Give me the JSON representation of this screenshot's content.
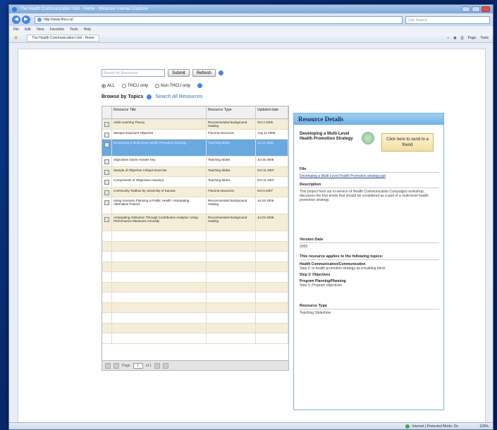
{
  "window": {
    "title": "The Health Communication Unit - Home - Windows Internet Explorer"
  },
  "address": {
    "url": "http://www.thcu.ca/",
    "search_placeholder": "Live Search"
  },
  "menu": [
    "File",
    "Edit",
    "View",
    "Favorites",
    "Tools",
    "Help"
  ],
  "favorites": {
    "tab_label": "The Health Communication Unit - Home",
    "page_btn": "Page",
    "tools_btn": "Tools"
  },
  "search": {
    "placeholder": "Search for Resources",
    "submit_label": "Submit",
    "refresh_label": "Refresh"
  },
  "filters": {
    "all": "ALL",
    "thcu": "THCU only",
    "non_thcu": "Non THCU only"
  },
  "browse": {
    "label": "Browse by Topics",
    "search_all": "Search All Resources"
  },
  "grid": {
    "headers": [
      "Resource Title",
      "Resource Type",
      "Updated date"
    ],
    "rows": [
      {
        "title": "Adult Learning Theory",
        "type": "Recommended background reading",
        "date": "Oct 4 2005"
      },
      {
        "title": "Mesquir Exposure Objective",
        "type": "Fiscal & resources",
        "date": "Aug 11 2006"
      },
      {
        "title": "Developing a Multi-Level Health Promotion Strategy",
        "type": "Teaching Slides",
        "date": "Jul 11 2006"
      },
      {
        "title": "Objectives Game Answer Key",
        "type": "Teaching Slides",
        "date": "Jul 26 2006"
      },
      {
        "title": "Sample of Objective Critique Exercise",
        "type": "Teaching Slides",
        "date": "Oct 11 2007"
      },
      {
        "title": "Components of Objectives Handout",
        "type": "Teaching Slides",
        "date": "Oct 11 2007"
      },
      {
        "title": "Community Toolbox by University of Kansas",
        "type": "Fiscal & resources",
        "date": "Oct 5 2007"
      },
      {
        "title": "Using Scenario Planning in Public Health: Anticipating Alternative Futures",
        "type": "Recommended background reading",
        "date": "Jul 26 2006"
      },
      {
        "title": "Anticipating Attribution Through Contribution Analysis: Using Performance Measures Annually",
        "type": "Recommended background reading",
        "date": "Jul 22 2006"
      }
    ],
    "empty_rows": 11,
    "pager": {
      "page_label": "Page",
      "page_value": "1",
      "of_label": "of 1"
    }
  },
  "details": {
    "header": "Resource Details",
    "title": "Developing a Multi-Level Health Promotion Strategy",
    "send_label": "Click here to send to a friend",
    "file_label": "File",
    "file_value": "Developing a Multi-Level Health Promotion strategy.ppt",
    "description_label": "Description",
    "description_value": "This project from our in-service of Health Communication Campaigns workshop, discusses the four levels that should be considered as a part of a multi-level health promotion strategy.",
    "version_label": "Version Date",
    "version_value": "2005",
    "applies_label": "This resource applies to the following topics:",
    "topics": [
      {
        "head": "Health Communication/Communication",
        "sub": "Step 2: Is health promotion strategy as a building block"
      },
      {
        "head": "Step 3: Objectives",
        "sub": ""
      },
      {
        "head": "Program Planning/Planning",
        "sub": "Step 3: Program objectives"
      }
    ],
    "type_label": "Resource Type",
    "type_value": "Teaching Slideshow"
  },
  "status": {
    "zone": "Internet | Protected Mode: On",
    "zoom": "100%"
  }
}
